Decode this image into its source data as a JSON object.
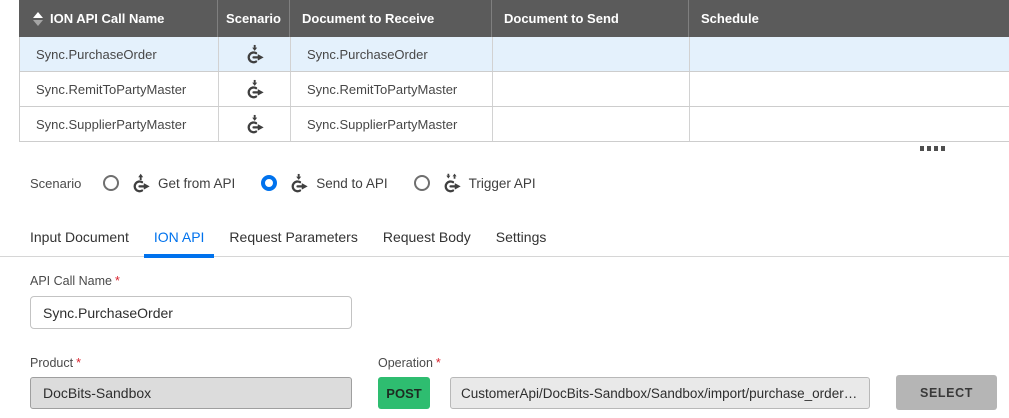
{
  "colors": {
    "header_bg": "#5b5b5b",
    "accent_blue": "#0072ed",
    "selected_row_bg": "#e4f1fc",
    "post_green": "#2ebd70",
    "required_red": "#d9232e",
    "select_button_bg": "#b5b5b5"
  },
  "table": {
    "columns": [
      "ION API Call Name",
      "Scenario",
      "Document to Receive",
      "Document to Send",
      "Schedule"
    ],
    "sorted_column": "ION API Call Name",
    "rows": [
      {
        "api_call_name": "Sync.PurchaseOrder",
        "scenario_icon": "send-to-api",
        "document_to_receive": "Sync.PurchaseOrder",
        "document_to_send": "",
        "schedule": "",
        "selected": true
      },
      {
        "api_call_name": "Sync.RemitToPartyMaster",
        "scenario_icon": "send-to-api",
        "document_to_receive": "Sync.RemitToPartyMaster",
        "document_to_send": "",
        "schedule": "",
        "selected": false
      },
      {
        "api_call_name": "Sync.SupplierPartyMaster",
        "scenario_icon": "send-to-api",
        "document_to_receive": "Sync.SupplierPartyMaster",
        "document_to_send": "",
        "schedule": "",
        "selected": false
      }
    ]
  },
  "scenario_group": {
    "label": "Scenario",
    "options": [
      {
        "label": "Get from API",
        "icon": "get-from-api-icon",
        "checked": false
      },
      {
        "label": "Send to API",
        "icon": "send-to-api-icon",
        "checked": true
      },
      {
        "label": "Trigger API",
        "icon": "trigger-api-icon",
        "checked": false
      }
    ]
  },
  "tabs": [
    {
      "label": "Input Document",
      "active": false
    },
    {
      "label": "ION API",
      "active": true
    },
    {
      "label": "Request Parameters",
      "active": false
    },
    {
      "label": "Request Body",
      "active": false
    },
    {
      "label": "Settings",
      "active": false
    }
  ],
  "form": {
    "api_call_name": {
      "label": "API Call Name",
      "required_marker": "*",
      "value": "Sync.PurchaseOrder"
    },
    "product": {
      "label": "Product",
      "required_marker": "*",
      "value": "DocBits-Sandbox"
    },
    "operation": {
      "label": "Operation",
      "required_marker": "*",
      "method": "POST",
      "endpoint": "CustomerApi/DocBits-Sandbox/Sandbox/import/purchase_order…",
      "select_button": "SELECT"
    }
  }
}
